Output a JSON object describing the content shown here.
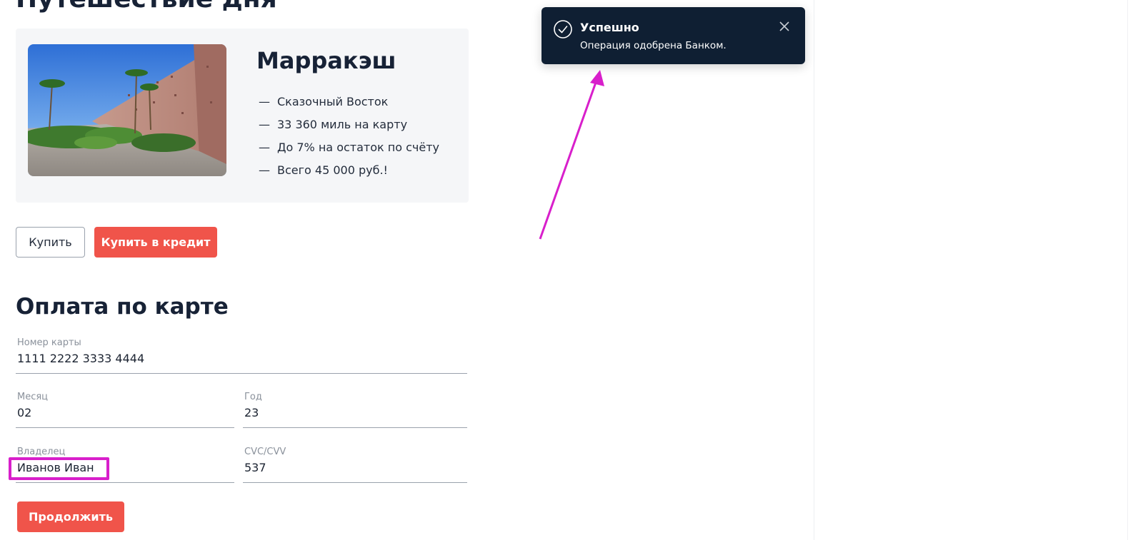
{
  "page": {
    "title": "Путешествие дня"
  },
  "offer": {
    "title": "Марракэш",
    "features": [
      "Сказочный Восток",
      "33 360 миль на карту",
      "До 7% на остаток по счёту",
      "Всего 45 000 руб.!"
    ],
    "dash": "—"
  },
  "actions": {
    "buy_label": "Купить",
    "credit_label": "Купить в кредит"
  },
  "payment": {
    "title": "Оплата по карте",
    "card_number": {
      "label": "Номер карты",
      "value": "1111 2222 3333 4444"
    },
    "month": {
      "label": "Месяц",
      "value": "02"
    },
    "year": {
      "label": "Год",
      "value": "23"
    },
    "owner": {
      "label": "Владелец",
      "value": "Иванов Иван"
    },
    "cvc": {
      "label": "CVC/CVV",
      "value": "537"
    },
    "continue_label": "Продолжить"
  },
  "notification": {
    "title": "Успешно",
    "message": "Операция одобрена Банком.",
    "icon": "check-circle-icon",
    "close_icon": "close-icon"
  },
  "colors": {
    "accent": "#f0544a",
    "toast_bg": "#0f1f33",
    "annotation": "#d81fcb",
    "heading": "#172236"
  }
}
